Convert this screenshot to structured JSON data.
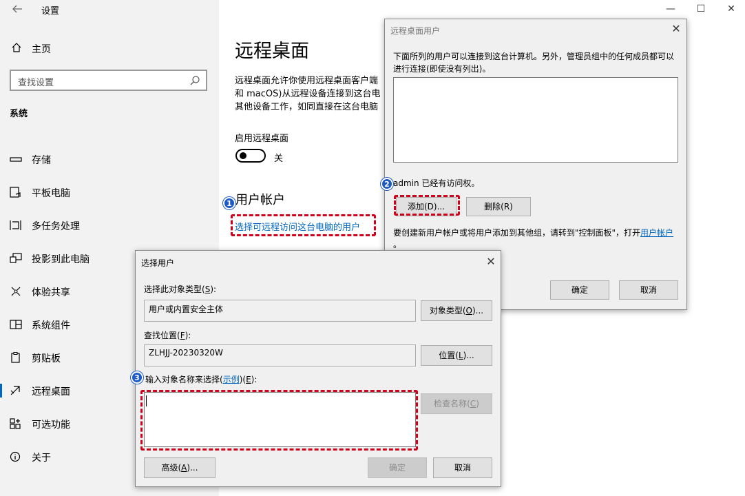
{
  "window": {
    "title": "设置",
    "minimize": "—",
    "maximize": "☐",
    "close": "✕"
  },
  "sidebar": {
    "home": "主页",
    "search_placeholder": "查找设置",
    "section": "系统",
    "items": [
      {
        "label": "存储"
      },
      {
        "label": "平板电脑"
      },
      {
        "label": "多任务处理"
      },
      {
        "label": "投影到此电脑"
      },
      {
        "label": "体验共享"
      },
      {
        "label": "系统组件"
      },
      {
        "label": "剪贴板"
      },
      {
        "label": "远程桌面",
        "selected": true
      },
      {
        "label": "可选功能"
      },
      {
        "label": "关于"
      }
    ]
  },
  "main": {
    "title": "远程桌面",
    "desc_lines": [
      "远程桌面允许你使用远程桌面客户端",
      "和 macOS)从远程设备连接到这台电",
      "其他设备工作，如同直接在这台电脑"
    ],
    "enable_label": "启用远程桌面",
    "toggle_state": "关",
    "user_accounts_title": "用户帐户",
    "select_users_link": "选择可远程访问这台电脑的用户"
  },
  "badges": {
    "b1": "1",
    "b2": "2",
    "b3": "3"
  },
  "rdu_dialog": {
    "title": "远程桌面用户",
    "desc_line1": "下面所列的用户可以连接到这台计算机。另外，管理员组中的任何成员都可以",
    "desc_line2": "进行连接(即使没有列出)。",
    "access_text": "admin 已经有访问权。",
    "add": "添加(D)...",
    "remove": "删除(R)",
    "hint_prefix": "要创建新用户帐户或将用户添加到其他组，请转到\"控制面板\"，打开",
    "hint_link": "用户帐户",
    "hint_suffix": "。",
    "ok": "确定",
    "cancel": "取消"
  },
  "select_users_dialog": {
    "title": "选择用户",
    "obj_type_label_pre": "选择此对象类型(",
    "obj_type_key": "S",
    "obj_type_label_post": "):",
    "obj_type_value": "用户或内置安全主体",
    "obj_type_btn_pre": "对象类型(",
    "obj_type_btn_key": "O",
    "obj_type_btn_post": ")...",
    "location_label_pre": "查找位置(",
    "location_key": "F",
    "location_label_post": "):",
    "location_value": "ZLHJJ-20230320W",
    "location_btn_pre": "位置(",
    "location_btn_key": "L",
    "location_btn_post": ")...",
    "names_label_pre": "输入对象名称来选择(",
    "names_link": "示例",
    "names_label_mid": ")(",
    "names_key": "E",
    "names_label_post": "):",
    "names_value": "",
    "check_pre": "检查名称(",
    "check_key": "C",
    "check_post": ")",
    "adv_pre": "高级(",
    "adv_key": "A",
    "adv_post": ")...",
    "ok": "确定",
    "cancel": "取消"
  },
  "colors": {
    "accent": "#0067c0",
    "highlight": "#d0021b",
    "badge": "#1e5bc6"
  }
}
